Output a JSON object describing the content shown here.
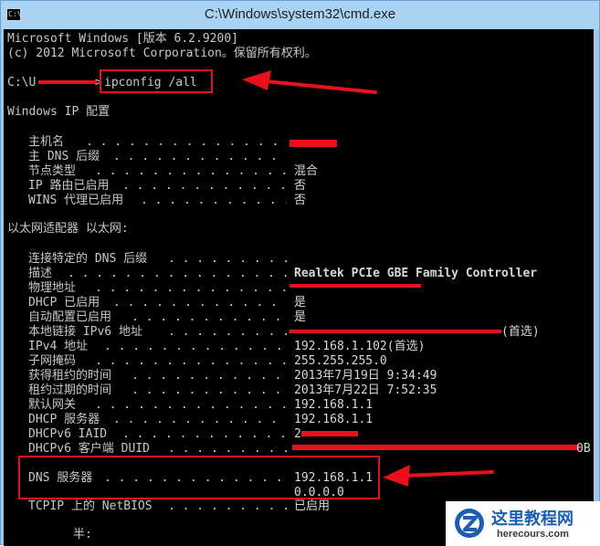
{
  "window": {
    "title": "C:\\Windows\\system32\\cmd.exe",
    "icon_text": "C:\\"
  },
  "console": {
    "header_line1": "Microsoft Windows [版本 6.2.9200]",
    "header_line2": "(c) 2012 Microsoft Corporation。保留所有权利。",
    "prompt_prefix": "C:\\U",
    "prompt_suffix": ">",
    "command": "ipconfig /all",
    "section_windows_ip": "Windows IP 配置",
    "section_ethernet": "以太网适配器 以太网:",
    "dot_leader": ". . . . . . . . . . . . . . . . . . . . . . . . . :",
    "windows_ip_rows": [
      {
        "label": "主机名",
        "value": ""
      },
      {
        "label": "主 DNS 后缀",
        "value": ""
      },
      {
        "label": "节点类型",
        "value": "混合"
      },
      {
        "label": "IP 路由已启用",
        "value": "否"
      },
      {
        "label": "WINS 代理已启用",
        "value": "否"
      }
    ],
    "ethernet_rows": [
      {
        "label": "连接特定的 DNS 后缀",
        "value": ""
      },
      {
        "label": "描述",
        "value": "Realtek PCIe GBE Family Controller"
      },
      {
        "label": "物理地址",
        "value": ""
      },
      {
        "label": "DHCP 已启用",
        "value": "是"
      },
      {
        "label": "自动配置已启用",
        "value": "是"
      },
      {
        "label": "本地链接 IPv6 地址",
        "value": "(首选)"
      },
      {
        "label": "IPv4 地址",
        "value": "192.168.1.102(首选)"
      },
      {
        "label": "子网掩码",
        "value": "255.255.255.0"
      },
      {
        "label": "获得租约的时间",
        "value": "2013年7月19日 9:34:49"
      },
      {
        "label": "租约过期的时间",
        "value": "2013年7月22日 7:52:35"
      },
      {
        "label": "默认网关",
        "value": "192.168.1.1"
      },
      {
        "label": "DHCP 服务器",
        "value": "192.168.1.1"
      },
      {
        "label": "DHCPv6 IAID",
        "value": "2"
      },
      {
        "label": "DHCPv6 客户端 DUID",
        "value": "0B"
      }
    ],
    "dns_label": "DNS 服务器",
    "dns_servers": [
      "192.168.1.1",
      "0.0.0.0"
    ],
    "netbios_label": "TCPIP 上的 NetBIOS",
    "netbios_value": "已启用",
    "trailing_label": "半:"
  },
  "watermark": {
    "title": "这里教程网",
    "url": "herecours.com"
  },
  "colors": {
    "console_bg": "#000000",
    "console_text": "#c8c8c8",
    "annotation_red": "#e8101a",
    "title_bar": "#a9d3f4"
  }
}
